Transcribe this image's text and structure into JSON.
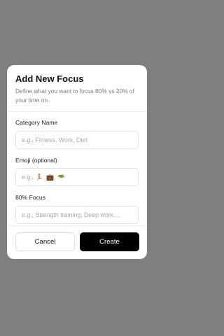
{
  "modal": {
    "title": "Add New Focus",
    "subtitle": "Define what you want to focus 80% vs 20% of your time on.",
    "fields": {
      "category": {
        "label": "Category Name",
        "placeholder": "e.g., Fitness, Work, Diet",
        "value": ""
      },
      "emoji": {
        "label": "Emoji (optional)",
        "placeholder": "e.g., 🏃, 💼, 🥗",
        "value": ""
      },
      "focus80": {
        "label": "80% Focus",
        "placeholder": "e.g., Strength training, Deep work,...",
        "value": ""
      }
    },
    "buttons": {
      "cancel": "Cancel",
      "create": "Create"
    }
  },
  "colors": {
    "overlay": "#7f7f7f",
    "primary_button": "#000000"
  }
}
